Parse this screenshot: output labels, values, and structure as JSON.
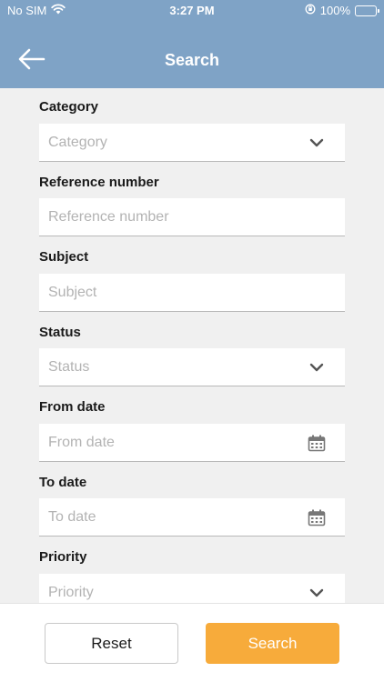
{
  "status_bar": {
    "carrier": "No SIM",
    "time": "3:27 PM",
    "battery_percent": "100%",
    "battery_level": 1.0,
    "icons": [
      "wifi-icon",
      "orientation-lock-icon",
      "battery-charging-icon"
    ]
  },
  "nav": {
    "title": "Search",
    "back_icon": "back-arrow-icon"
  },
  "fields": [
    {
      "label": "Category",
      "placeholder": "Category",
      "type": "dropdown",
      "icon": "chevron-down-icon"
    },
    {
      "label": "Reference number",
      "placeholder": "Reference number",
      "type": "text"
    },
    {
      "label": "Subject",
      "placeholder": "Subject",
      "type": "text"
    },
    {
      "label": "Status",
      "placeholder": "Status",
      "type": "dropdown",
      "icon": "chevron-down-icon"
    },
    {
      "label": "From date",
      "placeholder": "From date",
      "type": "date",
      "icon": "calendar-icon"
    },
    {
      "label": "To date",
      "placeholder": "To date",
      "type": "date",
      "icon": "calendar-icon"
    },
    {
      "label": "Priority",
      "placeholder": "Priority",
      "type": "dropdown",
      "icon": "chevron-down-icon"
    }
  ],
  "footer": {
    "reset_label": "Reset",
    "search_label": "Search"
  },
  "colors": {
    "header": "#7fa3c6",
    "primary_button": "#f7ab3b",
    "background": "#f0f0f0",
    "battery_fill": "#4cd964"
  }
}
